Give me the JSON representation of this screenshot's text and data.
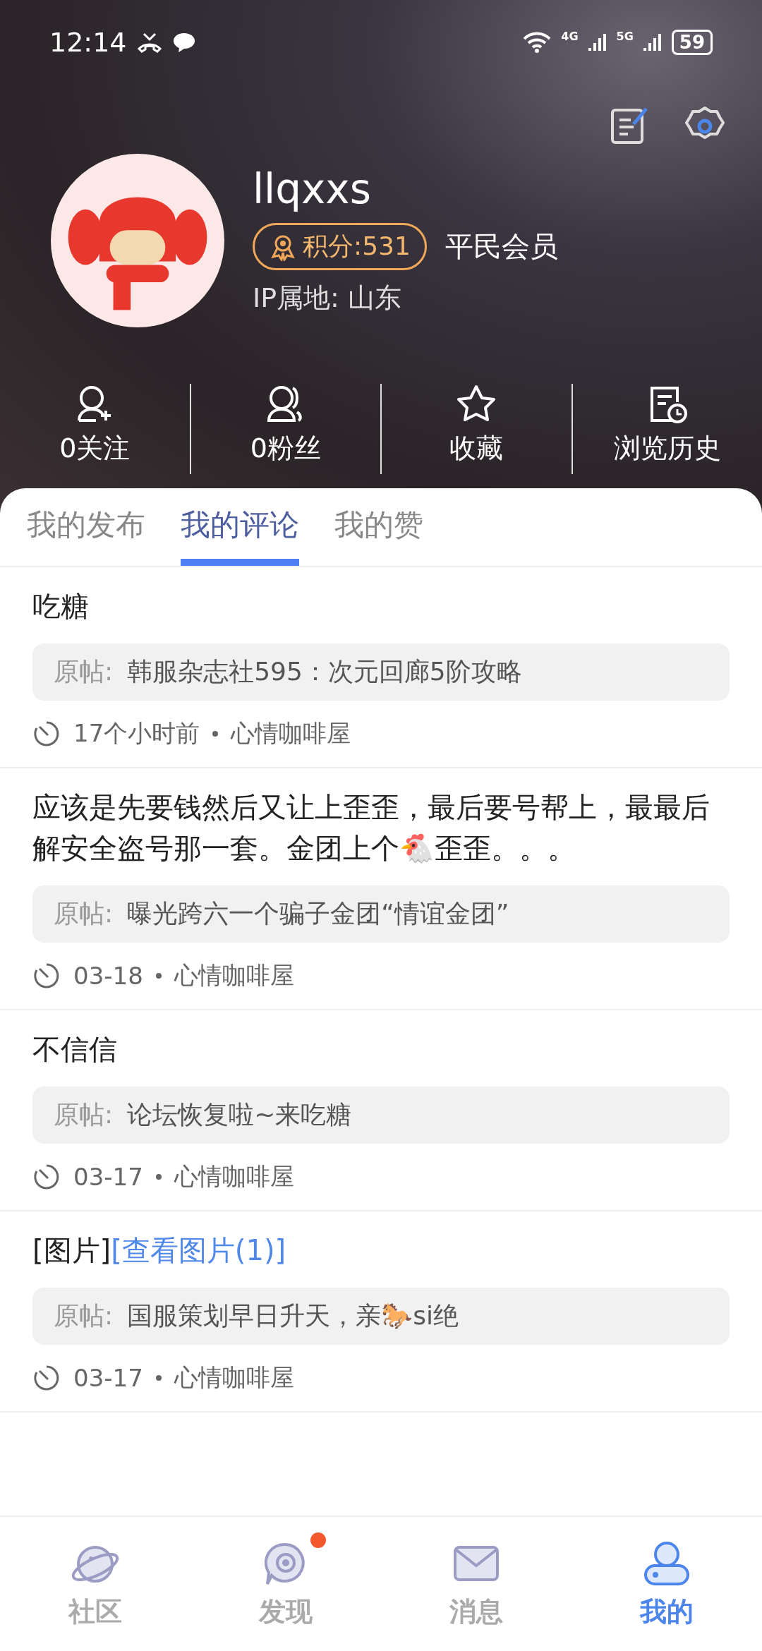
{
  "status_bar": {
    "time": "12:14",
    "battery": "59",
    "net_1": "4G",
    "net_2": "5G"
  },
  "profile": {
    "username": "llqxxs",
    "points": "积分:531",
    "member_level": "平民会员",
    "ip_location": "IP属地: 山东"
  },
  "stats": [
    {
      "kind": "follow",
      "label": "0关注"
    },
    {
      "kind": "fans",
      "label": "0粉丝"
    },
    {
      "kind": "star",
      "label": "收藏"
    },
    {
      "kind": "history",
      "label": "浏览历史"
    }
  ],
  "tabs": [
    {
      "label": "我的发布",
      "selected": false
    },
    {
      "label": "我的评论",
      "selected": true
    },
    {
      "label": "我的赞",
      "selected": false
    }
  ],
  "comments": [
    {
      "text": "吃糖",
      "origin_label": "原帖:",
      "origin": "韩服杂志社595：次元回廊5阶攻略",
      "time": "17个小时前",
      "board": "心情咖啡屋"
    },
    {
      "text": "应该是先要钱然后又让上歪歪，最后要号帮上，最最后解安全盗号那一套。金团上个🐔歪歪。。。",
      "origin_label": "原帖:",
      "origin": "曝光跨六一个骗子金团“情谊金团”",
      "time": "03-18",
      "board": "心情咖啡屋"
    },
    {
      "text": "不信信",
      "origin_label": "原帖:",
      "origin": "论坛恢复啦~来吃糖",
      "time": "03-17",
      "board": "心情咖啡屋"
    },
    {
      "text": "[图片]",
      "link": "[查看图片(1)]",
      "origin_label": "原帖:",
      "origin": "国服策划早日升天，亲🐎si绝",
      "time": "03-17",
      "board": "心情咖啡屋"
    }
  ],
  "nav": [
    {
      "kind": "planet",
      "label": "社区",
      "selected": false,
      "badge": false
    },
    {
      "kind": "discover",
      "label": "发现",
      "selected": false,
      "badge": true
    },
    {
      "kind": "mail",
      "label": "消息",
      "selected": false,
      "badge": false
    },
    {
      "kind": "user",
      "label": "我的",
      "selected": true,
      "badge": false
    }
  ]
}
